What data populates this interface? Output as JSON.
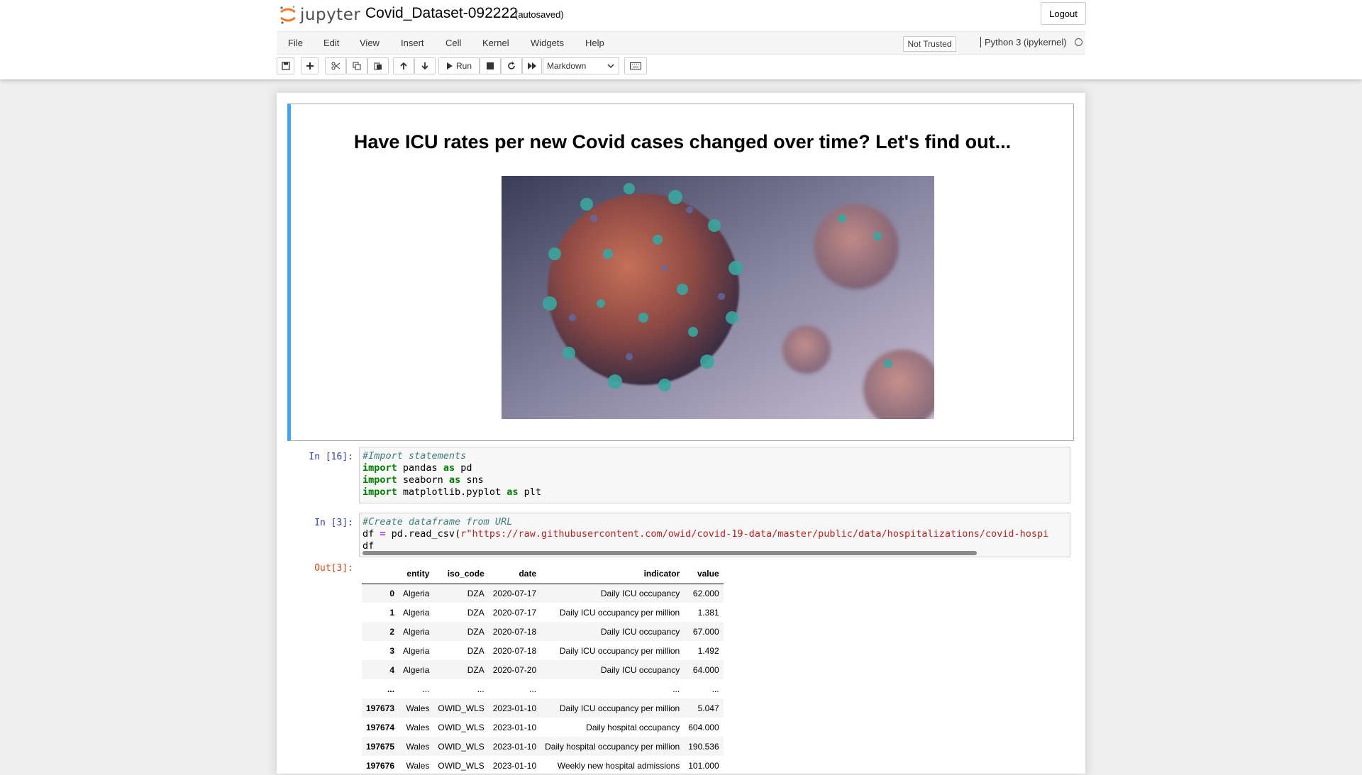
{
  "header": {
    "logo_text": "jupyter",
    "notebook_name": "Covid_Dataset-092222",
    "autosave_status": "(autosaved)",
    "logout_label": "Logout"
  },
  "menubar": {
    "items": [
      "File",
      "Edit",
      "View",
      "Insert",
      "Cell",
      "Kernel",
      "Widgets",
      "Help"
    ],
    "trust_label": "Not Trusted",
    "kernel_name": "Python 3 (ipykernel)"
  },
  "toolbar": {
    "run_label": "Run",
    "cell_type": "Markdown"
  },
  "colors": {
    "selected_cell_border": "#42a5f5",
    "input_prompt": "#303f9f",
    "output_prompt": "#d84315"
  },
  "cells": {
    "markdown_title": "Have ICU rates per new Covid cases changed over time? Let's find out...",
    "cell1": {
      "prompt": "In [16]:",
      "comment": "#Import statements",
      "lines": [
        [
          "import",
          " pandas ",
          "as",
          " pd"
        ],
        [
          "import",
          " seaborn ",
          "as",
          " sns"
        ],
        [
          "import",
          " matplotlib.pyplot ",
          "as",
          " plt"
        ]
      ]
    },
    "cell2": {
      "prompt": "In [3]:",
      "comment": "#Create dataframe from URL",
      "line2_prefix": "df ",
      "line2_op": "=",
      "line2_call": " pd.read_csv(",
      "line2_string": "r\"https://raw.githubusercontent.com/owid/covid-19-data/master/public/data/hospitalizations/covid-hospi",
      "line3": "df"
    },
    "output": {
      "prompt": "Out[3]:",
      "columns": [
        "",
        "entity",
        "iso_code",
        "date",
        "indicator",
        "value"
      ],
      "rows": [
        [
          "0",
          "Algeria",
          "DZA",
          "2020-07-17",
          "Daily ICU occupancy",
          "62.000"
        ],
        [
          "1",
          "Algeria",
          "DZA",
          "2020-07-17",
          "Daily ICU occupancy per million",
          "1.381"
        ],
        [
          "2",
          "Algeria",
          "DZA",
          "2020-07-18",
          "Daily ICU occupancy",
          "67.000"
        ],
        [
          "3",
          "Algeria",
          "DZA",
          "2020-07-18",
          "Daily ICU occupancy per million",
          "1.492"
        ],
        [
          "4",
          "Algeria",
          "DZA",
          "2020-07-20",
          "Daily ICU occupancy",
          "64.000"
        ],
        [
          "...",
          "...",
          "...",
          "...",
          "...",
          "..."
        ],
        [
          "197673",
          "Wales",
          "OWID_WLS",
          "2023-01-10",
          "Daily ICU occupancy per million",
          "5.047"
        ],
        [
          "197674",
          "Wales",
          "OWID_WLS",
          "2023-01-10",
          "Daily hospital occupancy",
          "604.000"
        ],
        [
          "197675",
          "Wales",
          "OWID_WLS",
          "2023-01-10",
          "Daily hospital occupancy per million",
          "190.536"
        ],
        [
          "197676",
          "Wales",
          "OWID_WLS",
          "2023-01-10",
          "Weekly new hospital admissions",
          "101.000"
        ]
      ]
    }
  }
}
